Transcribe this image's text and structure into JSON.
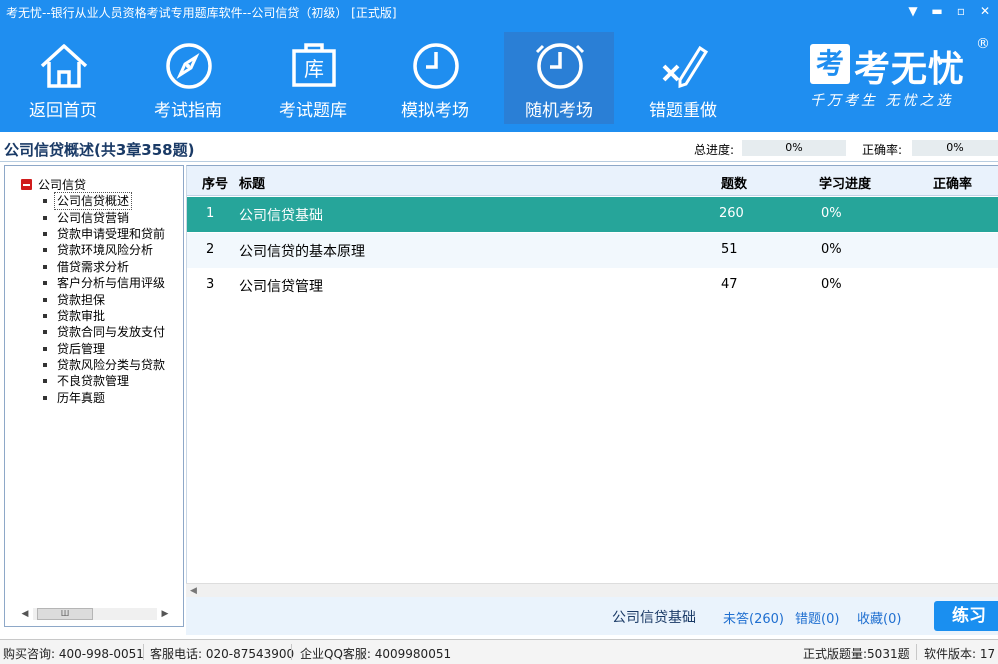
{
  "window": {
    "title": "考无忧--银行从业人员资格考试专用题库软件--公司信贷（初级）   [正式版]",
    "controls": [
      "▼",
      "▬",
      "▫",
      "✕"
    ]
  },
  "toolbar": {
    "items": [
      {
        "label": "返回首页",
        "icon": "home-icon"
      },
      {
        "label": "考试指南",
        "icon": "compass-icon"
      },
      {
        "label": "考试题库",
        "icon": "question-bank-icon",
        "icon_text": "库"
      },
      {
        "label": "模拟考场",
        "icon": "clock-icon"
      },
      {
        "label": "随机考场",
        "icon": "clock-icon"
      },
      {
        "label": "错题重做",
        "icon": "wrong-redo-icon"
      }
    ]
  },
  "brand": {
    "logo_char": "考",
    "name": "考无忧",
    "reg": "®",
    "slogan": "千万考生  无忧之选"
  },
  "header": {
    "title": "公司信贷概述(共3章358题)",
    "total_progress_label": "总进度:",
    "total_progress_value": "0%",
    "accuracy_label": "正确率:",
    "accuracy_value": "0%"
  },
  "tree": {
    "root": "公司信贷",
    "items": [
      "公司信贷概述",
      "公司信贷营销",
      "贷款申请受理和贷前",
      "贷款环境风险分析",
      "借贷需求分析",
      "客户分析与信用评级",
      "贷款担保",
      "贷款审批",
      "贷款合同与发放支付",
      "贷后管理",
      "贷款风险分类与贷款",
      "不良贷款管理",
      "历年真题"
    ],
    "selected_index": 0,
    "scroll_thumb": "Ш"
  },
  "table": {
    "headers": {
      "no": "序号",
      "title": "标题",
      "count": "题数",
      "progress": "学习进度",
      "accuracy": "正确率"
    },
    "rows": [
      {
        "no": "1",
        "title": "公司信贷基础",
        "count": "260",
        "progress": "0%",
        "accuracy": ""
      },
      {
        "no": "2",
        "title": "公司信贷的基本原理",
        "count": "51",
        "progress": "0%",
        "accuracy": ""
      },
      {
        "no": "3",
        "title": "公司信贷管理",
        "count": "47",
        "progress": "0%",
        "accuracy": ""
      }
    ],
    "selected_row": 0
  },
  "actionbar": {
    "current": "公司信贷基础",
    "unanswered": "未答(260)",
    "wrong": "错题(0)",
    "favorites": "收藏(0)",
    "practice": "练习"
  },
  "status": {
    "buy": "购买咨询: 400-998-0051",
    "service": "客服电话: 020-87543900",
    "qq": "企业QQ客服: 4009980051",
    "total": "正式版题量:5031题",
    "version": "软件版本: 17"
  },
  "colors": {
    "primary": "#1f8ef0",
    "selected_row": "#26a59a",
    "link": "#1f6fd0"
  }
}
